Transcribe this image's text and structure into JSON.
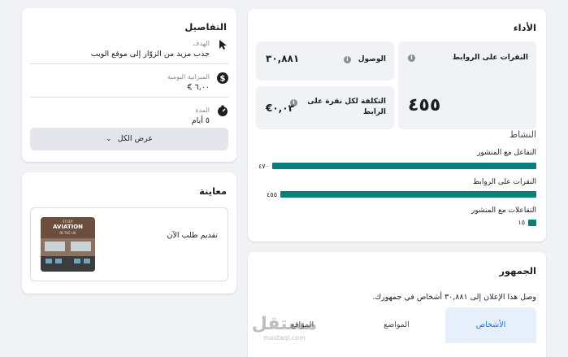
{
  "performance": {
    "title": "الأداء",
    "metrics": {
      "link_clicks": {
        "label": "النقرات على الروابط",
        "value": "٤٥٥"
      },
      "reach": {
        "label": "الوصول",
        "value": "٣٠,٨٨١"
      },
      "cpc": {
        "label": "التكلفة لكل نقرة على الرابط",
        "value": "٠,٠٣€"
      }
    },
    "activity": {
      "title": "النشاط",
      "rows": [
        {
          "label": "التفاعل مع المنشور",
          "value": "٤٧٠",
          "raw": 470
        },
        {
          "label": "النقرات على الروابط",
          "value": "٤٥٥",
          "raw": 455
        },
        {
          "label": "التفاعلات مع المنشور",
          "value": "١٥",
          "raw": 15
        }
      ]
    }
  },
  "audience": {
    "title": "الجمهور",
    "description": "وصل هذا الإعلان إلى ٣٠,٨٨١ أشخاص في جمهورك.",
    "tabs": [
      "الأشخاص",
      "المواضع",
      "المواقع"
    ],
    "active_tab": 0
  },
  "details": {
    "title": "التفاصيل",
    "goal": {
      "label": "الهدف",
      "value": "جذب مزيد من الزوّار إلى موقع الويب"
    },
    "budget": {
      "label": "الميزانية اليومية",
      "value": "٦,٠٠ €"
    },
    "duration": {
      "label": "المدة",
      "value": "٥ أيام"
    },
    "show_all": "عرض الكل"
  },
  "preview": {
    "title": "معاينة",
    "cta": "تقديم طلب الآن",
    "thumb": {
      "line1": "STUDY",
      "line2": "AVIATION",
      "line3": "IN THE UK"
    }
  },
  "watermark": {
    "text": "مستقل",
    "sub": "mostaql.com"
  },
  "colors": {
    "bar": "#0a7e7a",
    "accent": "#1b74e4",
    "tab_bg": "#e7f0fa"
  }
}
